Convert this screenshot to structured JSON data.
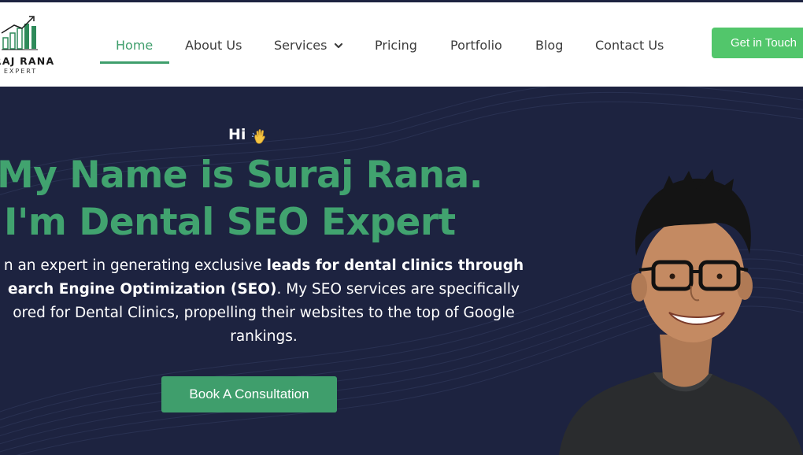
{
  "brand": {
    "name": "RAJ RANA",
    "tagline": "O EXPERT",
    "icon": "bar-chart-growth-logo"
  },
  "nav": {
    "items": [
      {
        "label": "Home",
        "active": true
      },
      {
        "label": "About Us",
        "active": false
      },
      {
        "label": "Services",
        "active": false,
        "has_dropdown": true
      },
      {
        "label": "Pricing",
        "active": false
      },
      {
        "label": "Portfolio",
        "active": false
      },
      {
        "label": "Blog",
        "active": false
      },
      {
        "label": "Contact Us",
        "active": false
      }
    ],
    "cta_label": "Get in Touch"
  },
  "hero": {
    "greeting": "Hi",
    "greeting_icon": "waving-hand-icon",
    "headline_line1": "My Name is Suraj Rana.",
    "headline_line2": "I'm Dental SEO Expert",
    "description": {
      "part1": "n an expert in generating exclusive ",
      "bold1": "leads for dental clinics through",
      "bold2": "earch Engine Optimization (SEO)",
      "part2": ". My SEO services are specifically",
      "part3": "ored for Dental Clinics, propelling their websites to the top of Google",
      "part4": "rankings."
    },
    "button_label": "Book A Consultation"
  },
  "colors": {
    "accent_green": "#3f9e6c",
    "cta_green": "#52c66b",
    "hero_bg": "#1d2340",
    "header_bg": "#ffffff"
  }
}
